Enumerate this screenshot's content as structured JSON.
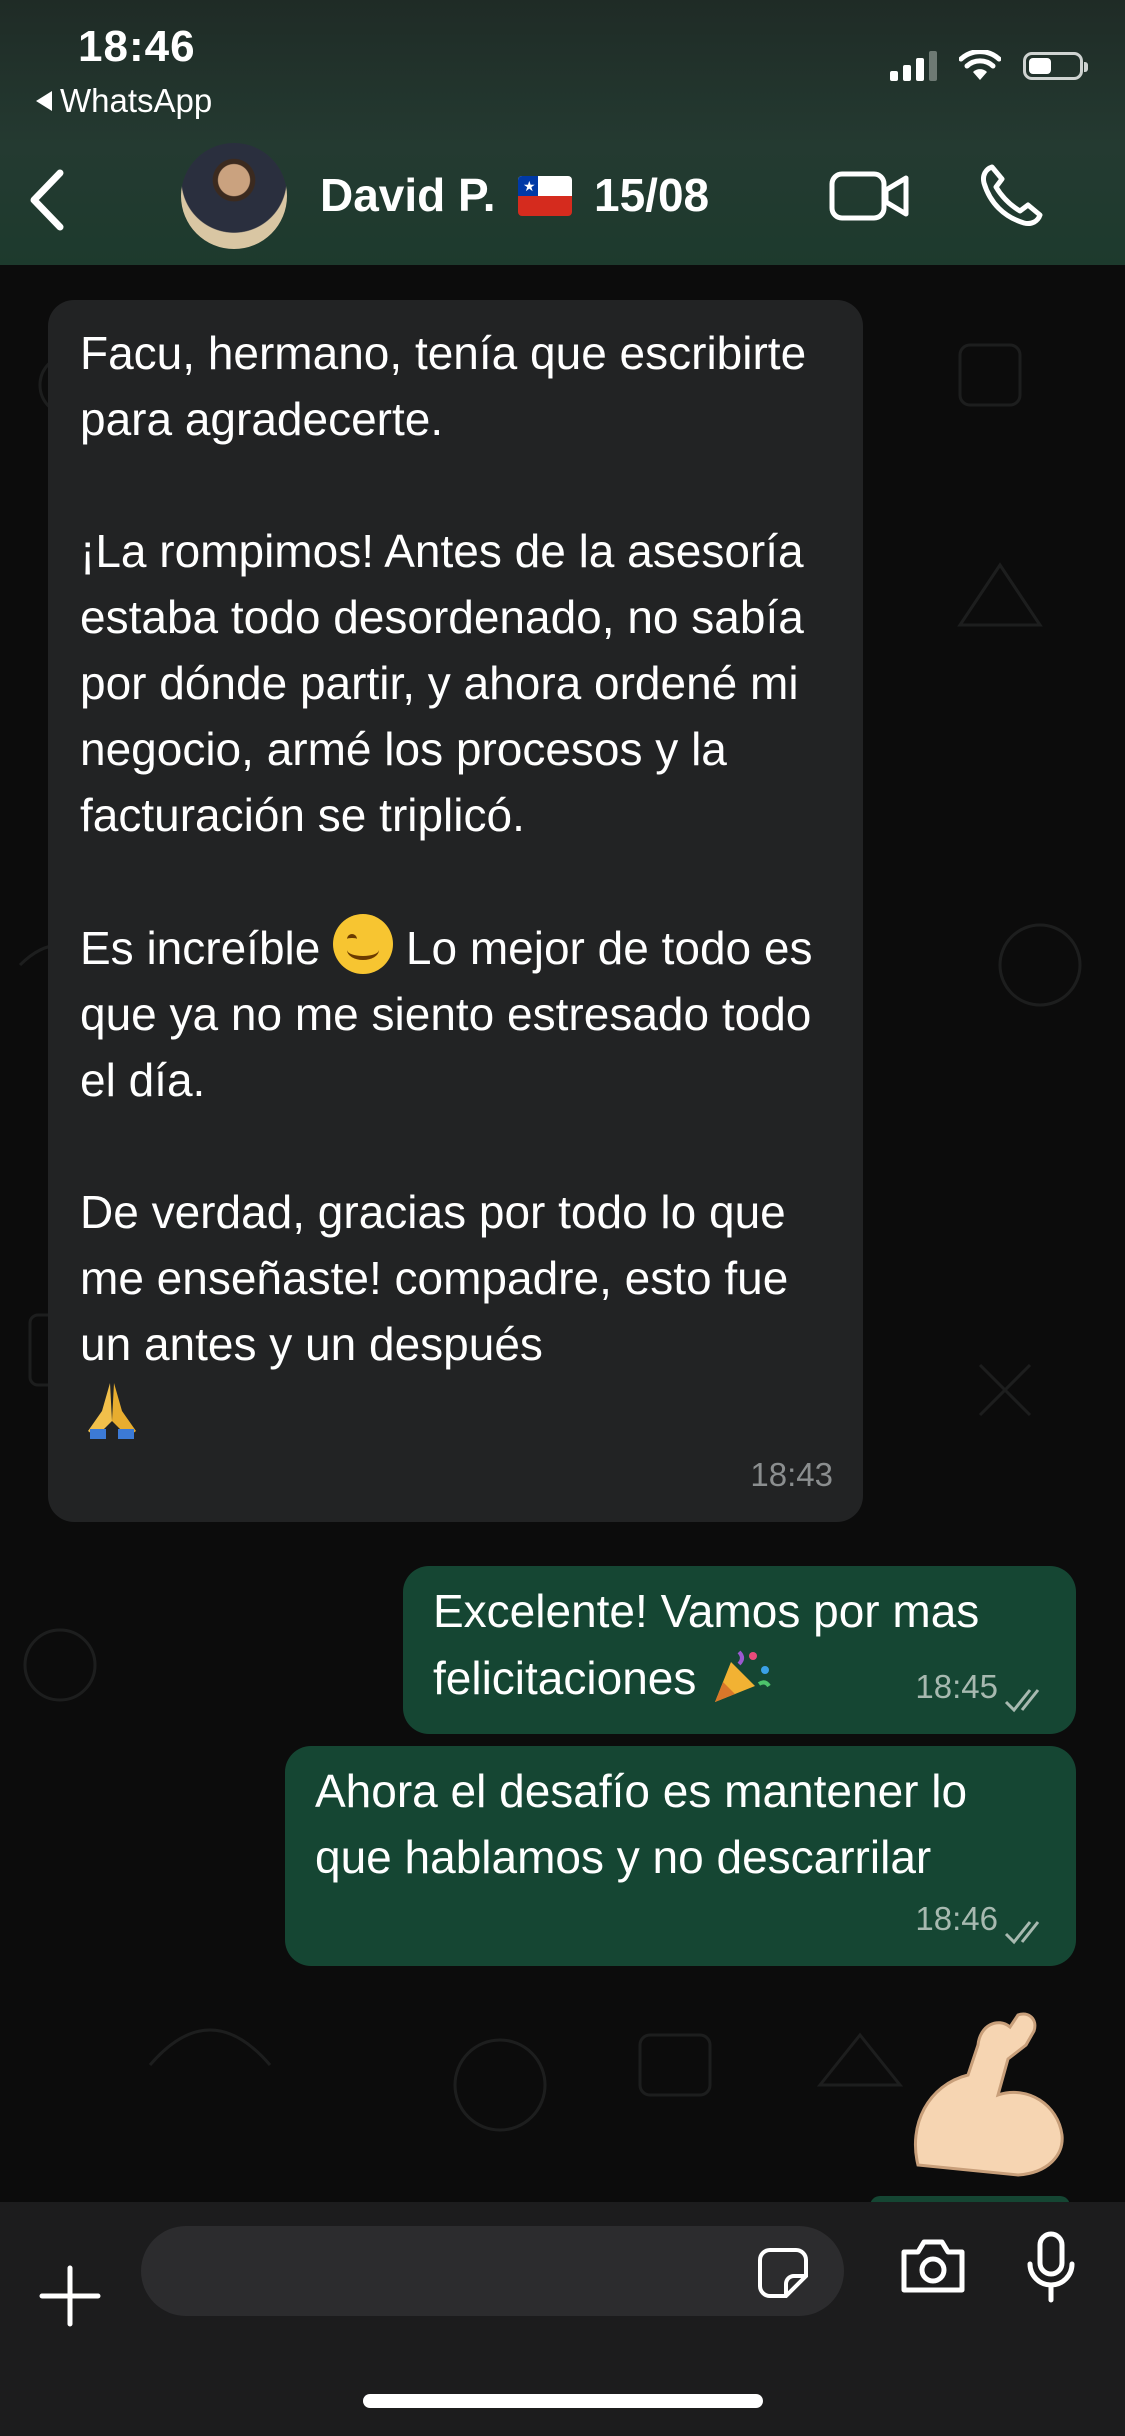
{
  "status_bar": {
    "time": "18:46",
    "back_app": "WhatsApp",
    "battery_level": 0.45
  },
  "header": {
    "contact_name": "David P.",
    "flag": "chile-flag",
    "contact_date": "15/08"
  },
  "messages": [
    {
      "direction": "incoming",
      "p1": "Facu, hermano, tenía que escribirte para agradecerte.",
      "p2": "¡La rompimos! Antes de la asesoría estaba todo desordenado, no sabía por dónde partir, y ahora ordené mi negocio, armé los procesos y la facturación se triplicó.",
      "p3a": "Es increíble ",
      "p3b": " Lo mejor de todo es que ya no me siento estresado todo el día.",
      "p4": "De verdad, gracias por todo lo que me enseñaste! compadre, esto fue un antes y un después",
      "time": "18:43"
    },
    {
      "direction": "outgoing",
      "text": "Excelente! Vamos por mas felicitaciones ",
      "time": "18:45",
      "status": "read"
    },
    {
      "direction": "outgoing",
      "text": "Ahora el desafío es mantener lo que hablamos y no descarrilar",
      "time": "18:46",
      "status": "read"
    }
  ],
  "sticker": "flexed-biceps",
  "input": {
    "placeholder": ""
  },
  "colors": {
    "incoming_bubble": "#222324",
    "outgoing_bubble": "#154633",
    "header": "#243a31"
  }
}
